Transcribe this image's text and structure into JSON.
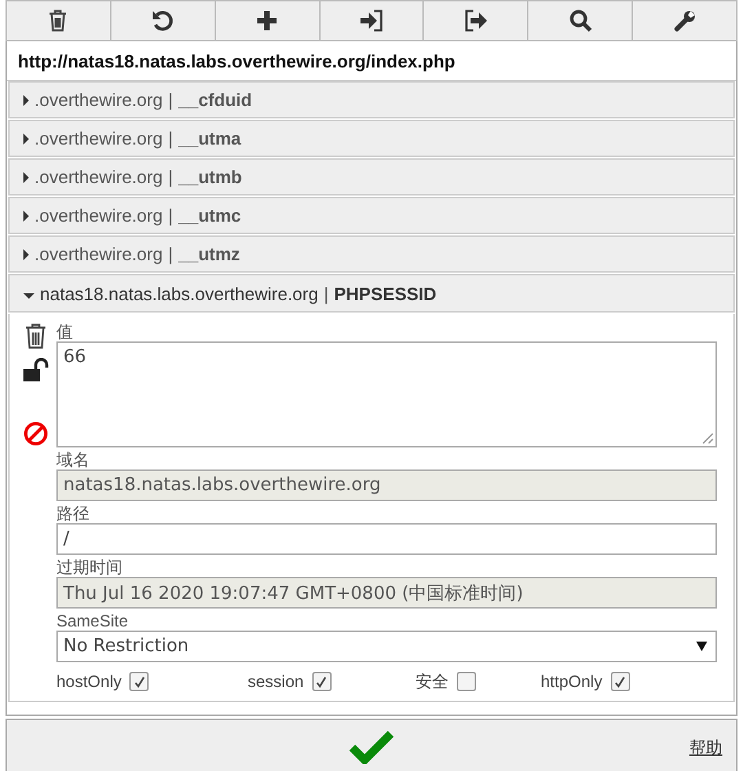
{
  "url": "http://natas18.natas.labs.overthewire.org/index.php",
  "cookies": [
    {
      "domain": ".overthewire.org",
      "separator": "|",
      "name": "__cfduid",
      "expanded": false
    },
    {
      "domain": ".overthewire.org",
      "separator": "|",
      "name": "__utma",
      "expanded": false
    },
    {
      "domain": ".overthewire.org",
      "separator": "|",
      "name": "__utmb",
      "expanded": false
    },
    {
      "domain": ".overthewire.org",
      "separator": "|",
      "name": "__utmc",
      "expanded": false
    },
    {
      "domain": ".overthewire.org",
      "separator": "|",
      "name": "__utmz",
      "expanded": false
    },
    {
      "domain": "natas18.natas.labs.overthewire.org",
      "separator": "|",
      "name": "PHPSESSID",
      "expanded": true
    }
  ],
  "editor": {
    "fields": [
      {
        "kind": "textarea",
        "label": "值",
        "value": "66",
        "readonly": false
      },
      {
        "kind": "text",
        "label": "域名",
        "value": "natas18.natas.labs.overthewire.org",
        "readonly": true
      },
      {
        "kind": "text",
        "label": "路径",
        "value": "/",
        "readonly": false
      },
      {
        "kind": "text",
        "label": "过期时间",
        "value": "Thu Jul 16 2020 19:07:47 GMT+0800 (中国标准时间)",
        "readonly": true
      },
      {
        "kind": "select",
        "label": "SameSite",
        "value": "No Restriction",
        "readonly": false
      }
    ],
    "flags": [
      {
        "label": "hostOnly",
        "checked": true
      },
      {
        "label": "session",
        "checked": true
      },
      {
        "label": "安全",
        "checked": false
      },
      {
        "label": "httpOnly",
        "checked": true
      }
    ]
  },
  "footer": {
    "help_link": "帮助"
  }
}
